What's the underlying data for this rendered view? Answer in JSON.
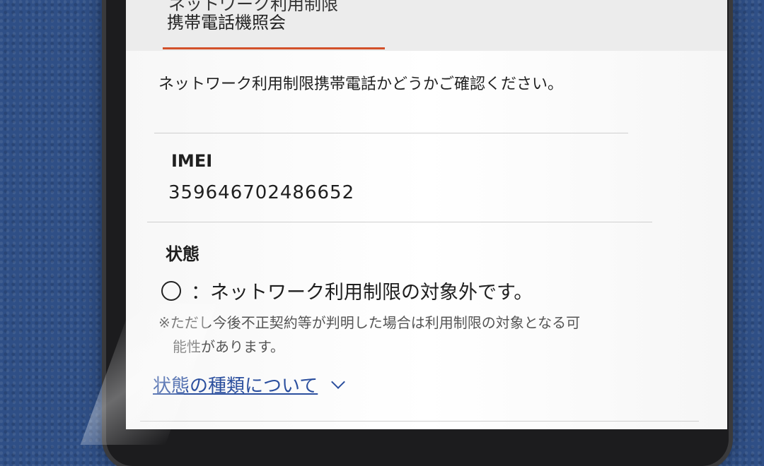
{
  "header": {
    "title_partial": "ネットワーク利用制限",
    "title": "携帯電話機照会",
    "accent_color": "#d2502a"
  },
  "intro": {
    "text": "ネットワーク利用制限携帯電話かどうかご確認ください。"
  },
  "imei": {
    "label": "IMEI",
    "value": "359646702486652"
  },
  "status": {
    "label": "状態",
    "symbol": "circle-icon",
    "text": "：ネットワーク利用制限の対象外です。",
    "note_line1": "※ただし今後不正契約等が判明した場合は利用制限の対象となる可",
    "note_line2": "能性があります。"
  },
  "details": {
    "link_text": "状態の種類について",
    "link_color": "#2b4f9e"
  }
}
